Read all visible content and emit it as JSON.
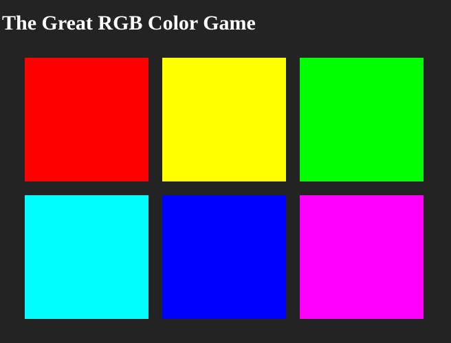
{
  "header": {
    "title": "The Great RGB Color Game"
  },
  "squares": [
    {
      "color": "#ff0000"
    },
    {
      "color": "#ffff00"
    },
    {
      "color": "#00ff00"
    },
    {
      "color": "#00ffff"
    },
    {
      "color": "#0000ff"
    },
    {
      "color": "#ff00ff"
    }
  ],
  "colors": {
    "background": "#232323",
    "title_text": "#ffffff"
  }
}
